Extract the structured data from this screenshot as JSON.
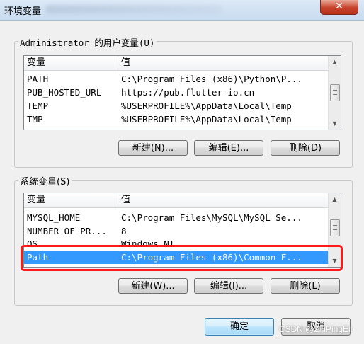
{
  "window": {
    "title": "环境变量",
    "close_glyph": "✕"
  },
  "user_vars": {
    "group_label": "Administrator 的用户变量(U)",
    "headers": {
      "name": "变量",
      "value": "值"
    },
    "rows": [
      {
        "name": "PATH",
        "value": "C:\\Program Files (x86)\\Python\\P..."
      },
      {
        "name": "PUB_HOSTED_URL",
        "value": "https://pub.flutter-io.cn"
      },
      {
        "name": "TEMP",
        "value": "%USERPROFILE%\\AppData\\Local\\Temp"
      },
      {
        "name": "TMP",
        "value": "%USERPROFILE%\\AppData\\Local\\Temp"
      }
    ],
    "buttons": {
      "new": "新建(N)...",
      "edit": "编辑(E)...",
      "delete": "删除(D)"
    }
  },
  "system_vars": {
    "group_label": "系统变量(S)",
    "headers": {
      "name": "变量",
      "value": "值"
    },
    "rows": [
      {
        "name": "MYSQL_HOME",
        "value": "C:\\Program Files\\MySQL\\MySQL Se..."
      },
      {
        "name": "NUMBER_OF_PR...",
        "value": "8"
      },
      {
        "name": "OS",
        "value": "Windows_NT"
      },
      {
        "name": "Path",
        "value": "C:\\Program Files (x86)\\Common F..."
      }
    ],
    "selected_row": "Path",
    "buttons": {
      "new": "新建(W)...",
      "edit": "编辑(I)...",
      "delete": "删除(L)"
    }
  },
  "footer": {
    "ok": "确定",
    "cancel": "取消",
    "watermark": "CSDN @ZhiPingEit"
  },
  "colors": {
    "selection": "#3399ff",
    "highlight": "#ff1a1a"
  }
}
